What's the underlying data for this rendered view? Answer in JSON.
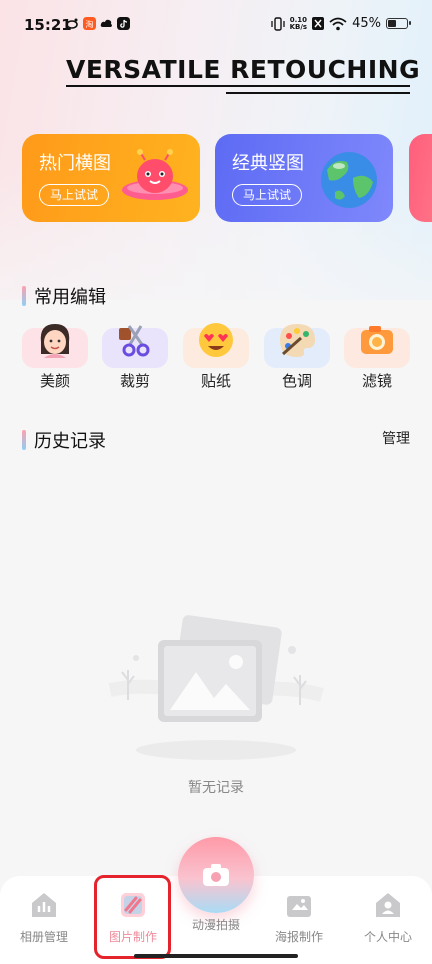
{
  "status_bar": {
    "time": "15:21",
    "net_speed_value": "0.10",
    "net_speed_unit": "KB/s",
    "battery_percent": "45%",
    "battery_level": 0.45,
    "app_icons": [
      "weibo-icon",
      "taobao-icon",
      "cloud-icon",
      "tiktok-icon"
    ]
  },
  "header": {
    "title": "VERSATILE RETOUCHING"
  },
  "feature_cards": [
    {
      "title": "热门横图",
      "button": "马上试试",
      "icon": "ufo-character-icon",
      "color": "#ffa51d"
    },
    {
      "title": "经典竖图",
      "button": "马上试试",
      "icon": "globe-icon",
      "color": "#6875f6"
    },
    {
      "title": "",
      "button": "",
      "icon": "",
      "color": "#ff6a80"
    }
  ],
  "edit_section": {
    "title": "常用编辑",
    "tools": [
      {
        "label": "美颜",
        "icon": "woman-face-icon",
        "bg": "#fde3e8"
      },
      {
        "label": "裁剪",
        "icon": "scissors-icon",
        "bg": "#e9e4fb"
      },
      {
        "label": "贴纸",
        "icon": "heart-eyes-emoji-icon",
        "bg": "#fdebe0"
      },
      {
        "label": "色调",
        "icon": "palette-icon",
        "bg": "#e3ecfb"
      },
      {
        "label": "滤镜",
        "icon": "camera-filter-icon",
        "bg": "#fde9e0"
      }
    ]
  },
  "history_section": {
    "title": "历史记录",
    "manage_label": "管理",
    "empty_text": "暂无记录"
  },
  "bottom_nav": {
    "items": [
      {
        "label": "相册管理",
        "icon": "album-icon",
        "active": false
      },
      {
        "label": "图片制作",
        "icon": "image-edit-icon",
        "active": true
      },
      {
        "label": "海报制作",
        "icon": "poster-icon",
        "active": false
      },
      {
        "label": "个人中心",
        "icon": "profile-icon",
        "active": false
      }
    ],
    "camera_label": "动漫拍摄",
    "camera_icon": "camera-icon"
  }
}
